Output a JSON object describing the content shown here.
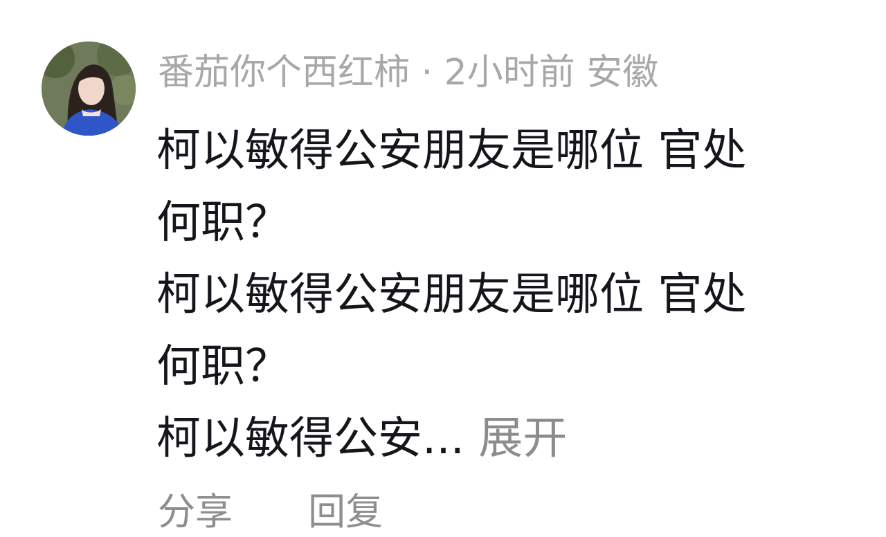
{
  "comment": {
    "username": "番茄你个西红柿",
    "separator": "·",
    "time": "2小时前",
    "location": "安徽",
    "body_lines": [
      "柯以敏得公安朋友是哪位 官处",
      "何职？",
      "柯以敏得公安朋友是哪位 官处",
      "何职？",
      "柯以敏得公安..."
    ],
    "expand_label": "展开",
    "actions": {
      "share_label": "分享",
      "reply_label": "回复"
    }
  }
}
